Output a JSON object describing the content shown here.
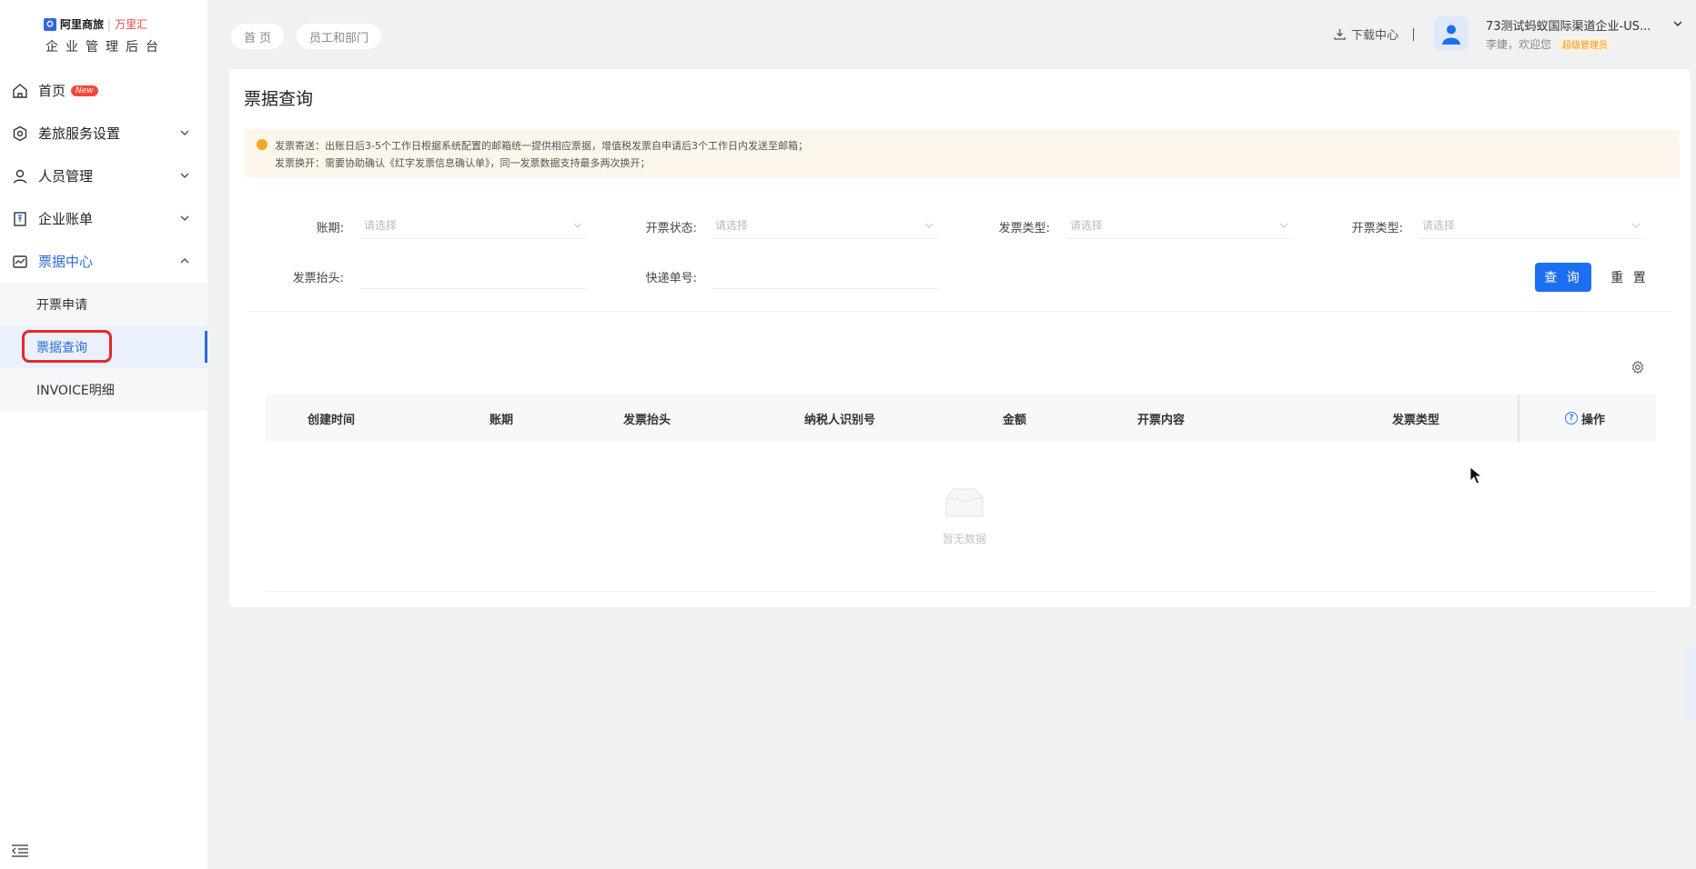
{
  "brand": {
    "logo_text": "阿里商旅",
    "partner": "万里汇",
    "title": "企业管理后台"
  },
  "sidebar": {
    "items": [
      {
        "label": "首页",
        "badge": "New",
        "icon": "home-icon"
      },
      {
        "label": "差旅服务设置",
        "icon": "settings-icon"
      },
      {
        "label": "人员管理",
        "icon": "user-icon"
      },
      {
        "label": "企业账单",
        "icon": "bill-icon"
      },
      {
        "label": "票据中心",
        "icon": "invoice-icon"
      }
    ],
    "submenu": [
      {
        "label": "开票申请"
      },
      {
        "label": "票据查询"
      },
      {
        "label": "INVOICE明细"
      }
    ]
  },
  "breadcrumbs": [
    "首 页",
    "员工和部门"
  ],
  "header": {
    "download": "下载中心",
    "user_name": "73测试蚂蚁国际渠道企业-US...",
    "welcome": "李婕，欢迎您",
    "role": "超级管理员"
  },
  "page": {
    "title": "票据查询",
    "notice_line1": "发票寄送：出账日后3-5个工作日根据系统配置的邮箱统一提供相应票据，增值税发票自申请后3个工作日内发送至邮箱；",
    "notice_line2": "发票换开：需要协助确认《红字发票信息确认单》，同一发票数据支持最多两次换开；"
  },
  "filters": {
    "period_label": "账期:",
    "status_label": "开票状态:",
    "invoice_type_label": "发票类型:",
    "issue_type_label": "开票类型:",
    "title_label": "发票抬头:",
    "express_label": "快递单号:",
    "placeholder": "请选择",
    "query_button": "查 询",
    "reset_button": "重 置"
  },
  "table": {
    "columns": [
      "创建时间",
      "账期",
      "发票抬头",
      "纳税人识别号",
      "金额",
      "开票内容",
      "发票类型",
      "操作"
    ],
    "empty_text": "暂无数据"
  },
  "colors": {
    "primary": "#1d6ff2",
    "highlight_box": "#e8262b",
    "notice_bg": "#fdf6ec"
  }
}
